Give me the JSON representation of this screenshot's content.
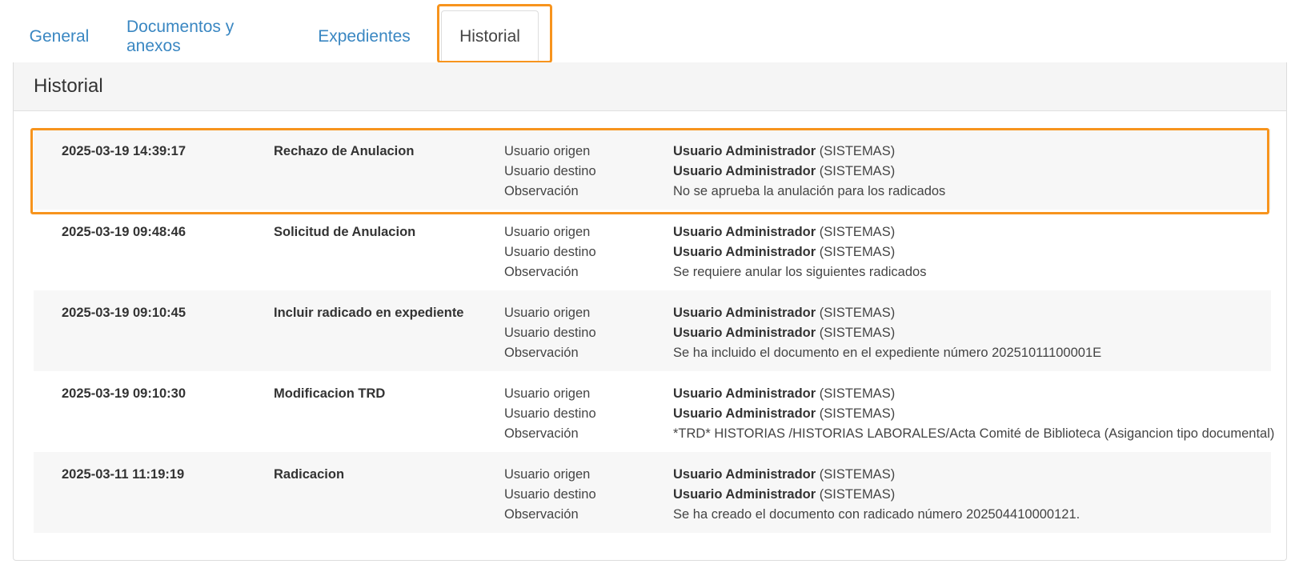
{
  "tabs": [
    {
      "label": "General"
    },
    {
      "label": "Documentos y anexos"
    },
    {
      "label": "Expedientes"
    },
    {
      "label": "Historial"
    }
  ],
  "panel": {
    "title": "Historial"
  },
  "field_labels": {
    "origin": "Usuario origen",
    "destination": "Usuario destino",
    "observation": "Observación"
  },
  "history": [
    {
      "date": "2025-03-19 14:39:17",
      "event": "Rechazo de Anulacion",
      "origin_user": "Usuario Administrador",
      "origin_dept": "(SISTEMAS)",
      "dest_user": "Usuario Administrador",
      "dest_dept": "(SISTEMAS)",
      "observation": "No se aprueba la anulación para los radicados"
    },
    {
      "date": "2025-03-19 09:48:46",
      "event": "Solicitud de Anulacion",
      "origin_user": "Usuario Administrador",
      "origin_dept": "(SISTEMAS)",
      "dest_user": "Usuario Administrador",
      "dest_dept": "(SISTEMAS)",
      "observation": "Se requiere anular los siguientes radicados"
    },
    {
      "date": "2025-03-19 09:10:45",
      "event": "Incluir radicado en expediente",
      "origin_user": "Usuario Administrador",
      "origin_dept": "(SISTEMAS)",
      "dest_user": "Usuario Administrador",
      "dest_dept": "(SISTEMAS)",
      "observation": "Se ha incluido el documento en el expediente número 20251011100001E"
    },
    {
      "date": "2025-03-19 09:10:30",
      "event": "Modificacion TRD",
      "origin_user": "Usuario Administrador",
      "origin_dept": "(SISTEMAS)",
      "dest_user": "Usuario Administrador",
      "dest_dept": "(SISTEMAS)",
      "observation": "*TRD* HISTORIAS /HISTORIAS LABORALES/Acta Comité de Biblioteca (Asigancion tipo documental)"
    },
    {
      "date": "2025-03-11 11:19:19",
      "event": "Radicacion",
      "origin_user": "Usuario Administrador",
      "origin_dept": "(SISTEMAS)",
      "dest_user": "Usuario Administrador",
      "dest_dept": "(SISTEMAS)",
      "observation": "Se ha creado el documento con radicado número 202504410000121."
    }
  ],
  "colors": {
    "highlight": "#f7941d",
    "link": "#3a87c2"
  }
}
